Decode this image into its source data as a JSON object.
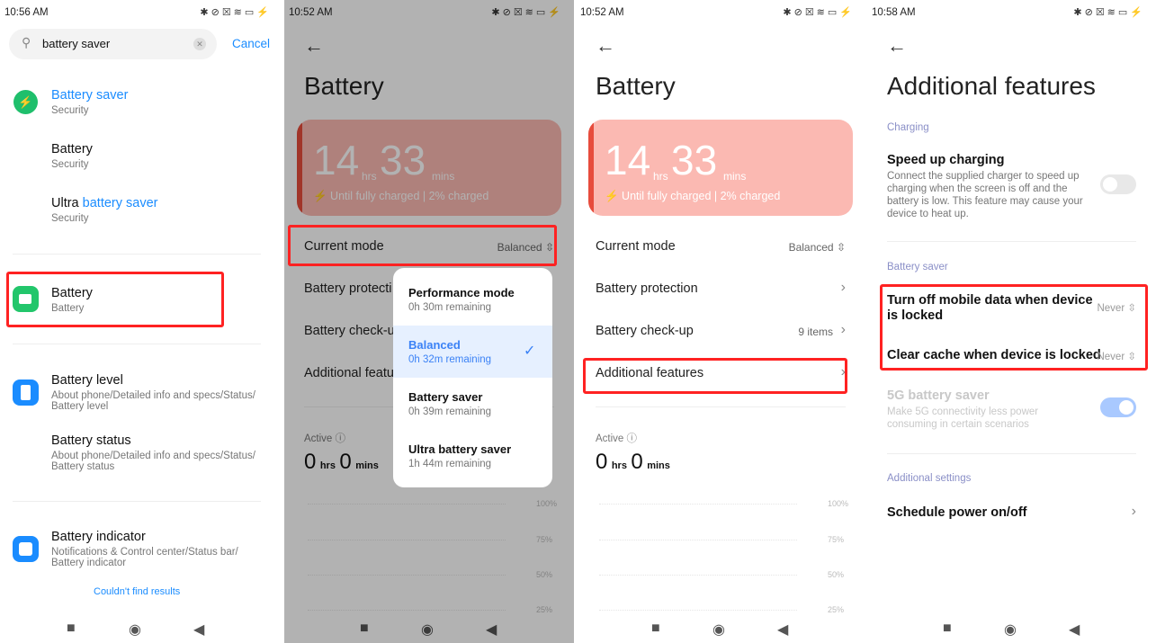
{
  "panel1": {
    "status_time": "10:56 AM",
    "search": {
      "value": "battery saver",
      "cancel": "Cancel"
    },
    "results": [
      {
        "title_plain": "",
        "title_hl": "Battery saver",
        "sub": "Security",
        "icon": "green-hexagon-bolt-icon"
      },
      {
        "title_plain": "Battery",
        "title_hl": "",
        "sub": "Security"
      },
      {
        "title_plain": "Ultra ",
        "title_hl": "battery saver",
        "sub": "Security"
      },
      {
        "title_plain": "Battery",
        "sub": "Battery",
        "icon": "green-battery-icon"
      },
      {
        "title_plain": "Battery level",
        "sub": "About phone/Detailed info and specs/Status/",
        "sub2": "Battery level",
        "icon": "blue-phone-icon"
      },
      {
        "title_plain": "Battery status",
        "sub": "About phone/Detailed info and specs/Status/",
        "sub2": "Battery status"
      },
      {
        "title_plain": "Battery indicator",
        "sub": "Notifications & Control center/Status bar/",
        "sub2": "Battery indicator",
        "icon": "blue-indicator-icon"
      }
    ],
    "footer": "Couldn't find results"
  },
  "battery_screen": {
    "title": "Battery",
    "hours": "14",
    "hrs": "hrs",
    "mins_val": "33",
    "mins": "mins",
    "charge_text": "Until fully charged | 2% charged",
    "current_mode": "Current mode",
    "current_mode_value": "Balanced",
    "protection": "Battery protection",
    "checkup": "Battery check-up",
    "checkup_value": "9 items",
    "additional": "Additional features",
    "active": "Active",
    "active_hours": "0",
    "active_mins": "0",
    "grid_labels": [
      "100%",
      "75%",
      "50%",
      "25%"
    ]
  },
  "panel2": {
    "status_time": "10:52 AM",
    "protection_cut": "Battery protecti",
    "checkup_cut": "Battery check-u",
    "additional_cut": "Additional featu",
    "modes": [
      {
        "name": "Performance mode",
        "remaining": "0h 30m remaining",
        "selected": false
      },
      {
        "name": "Balanced",
        "remaining": "0h 32m remaining",
        "selected": true
      },
      {
        "name": "Battery saver",
        "remaining": "0h 39m remaining",
        "selected": false
      },
      {
        "name": "Ultra battery saver",
        "remaining": "1h 44m remaining",
        "selected": false
      }
    ]
  },
  "panel3": {
    "status_time": "10:52 AM"
  },
  "panel4": {
    "status_time": "10:58 AM",
    "title": "Additional features",
    "charging_header": "Charging",
    "speed_title": "Speed up charging",
    "speed_desc": [
      "Connect the supplied charger to speed up",
      "charging when the screen is off and the",
      "battery is low. This feature may cause your",
      "device to heat up."
    ],
    "speed_on": false,
    "saver_header": "Battery saver",
    "mobile_data": [
      "Turn off mobile data when device",
      "is locked"
    ],
    "mobile_data_value": "Never",
    "clear_cache": "Clear cache when device is locked",
    "clear_cache_value": "Never",
    "fiveg_title": "5G battery saver",
    "fiveg_desc": [
      "Make 5G connectivity less power",
      "consuming in certain scenarios"
    ],
    "fiveg_on": true,
    "additional_header": "Additional settings",
    "schedule": "Schedule power on/off"
  },
  "colors": {
    "accent": "#1a8cff",
    "highlight": "#f22",
    "card": "#fbb9b2"
  }
}
